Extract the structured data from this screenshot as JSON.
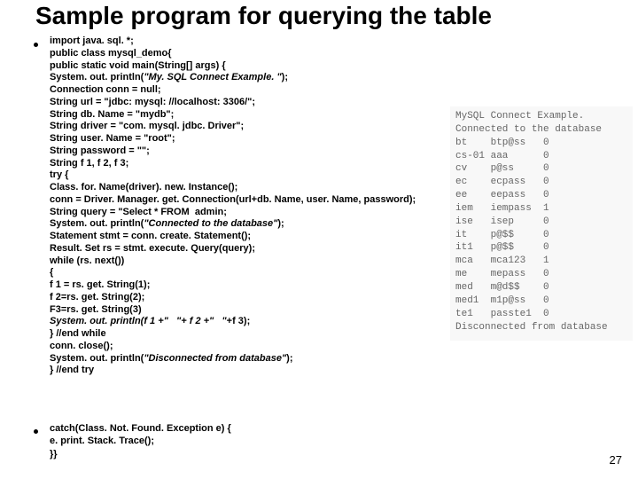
{
  "title": "Sample program for querying the table",
  "code": {
    "l1": "import java. sql. *;",
    "l2": "public class mysql_demo{",
    "l3": "public static void main(String[] args) {",
    "l4a": "System. out. println(",
    "l4b": "\"My. SQL Connect Example. \"",
    "l4c": ");",
    "l5": "Connection conn = null;",
    "l6": "String url = \"jdbc: mysql: //localhost: 3306/\";",
    "l7": "String db. Name = \"mydb\";",
    "l8": "String driver = \"com. mysql. jdbc. Driver\";",
    "l9": "String user. Name = \"root\";",
    "l10": "String password = \"\";",
    "l11": "String f 1, f 2, f 3;",
    "l12": "try {",
    "l13": "Class. for. Name(driver). new. Instance();",
    "l14": "conn = Driver. Manager. get. Connection(url+db. Name, user. Name, password);",
    "l15": "String query = \"Select * FROM  admin;",
    "l16a": "System. out. println(",
    "l16b": "\"Connected to the database\"",
    "l16c": ");",
    "l17": "Statement stmt = conn. create. Statement();",
    "l18": "Result. Set rs = stmt. execute. Query(query);",
    "l19": "while (rs. next())",
    "l20": "{",
    "l21": "f 1 = rs. get. String(1);",
    "l22": "f 2=rs. get. String(2);",
    "l23": "F3=rs. get. String(3)",
    "l24a": "System. out. println(f 1 +\"   \"+ f 2 +\"   \"",
    "l24b": "+f 3);",
    "l25": "} //end while",
    "l26": "conn. close();",
    "l27a": "System. out. println(",
    "l27b": "\"Disconnected from database\"",
    "l27c": ");",
    "l28": "} //end try"
  },
  "code2": {
    "l1": "catch(Class. Not. Found. Exception e) {",
    "l2": "e. print. Stack. Trace();",
    "l3": "}}"
  },
  "output": {
    "h": "MySQL Connect Example.",
    "c": "Connected to the database",
    "rows": [
      [
        "bt",
        "btp@ss",
        "0"
      ],
      [
        "cs-01",
        "aaa",
        "0"
      ],
      [
        "cv",
        "p@ss",
        "0"
      ],
      [
        "ec",
        "ecpass",
        "0"
      ],
      [
        "ee",
        "eepass",
        "0"
      ],
      [
        "iem",
        "iempass",
        "1"
      ],
      [
        "ise",
        "isep",
        "0"
      ],
      [
        "it",
        "p@$$",
        "0"
      ],
      [
        "it1",
        "p@$$",
        "0"
      ],
      [
        "mca",
        "mca123",
        "1"
      ],
      [
        "me",
        "mepass",
        "0"
      ],
      [
        "med",
        "m@d$$",
        "0"
      ],
      [
        "med1",
        "m1p@ss",
        "0"
      ],
      [
        "te1",
        "passte1",
        "0"
      ]
    ],
    "d": "Disconnected from database"
  },
  "pagenum": "27"
}
